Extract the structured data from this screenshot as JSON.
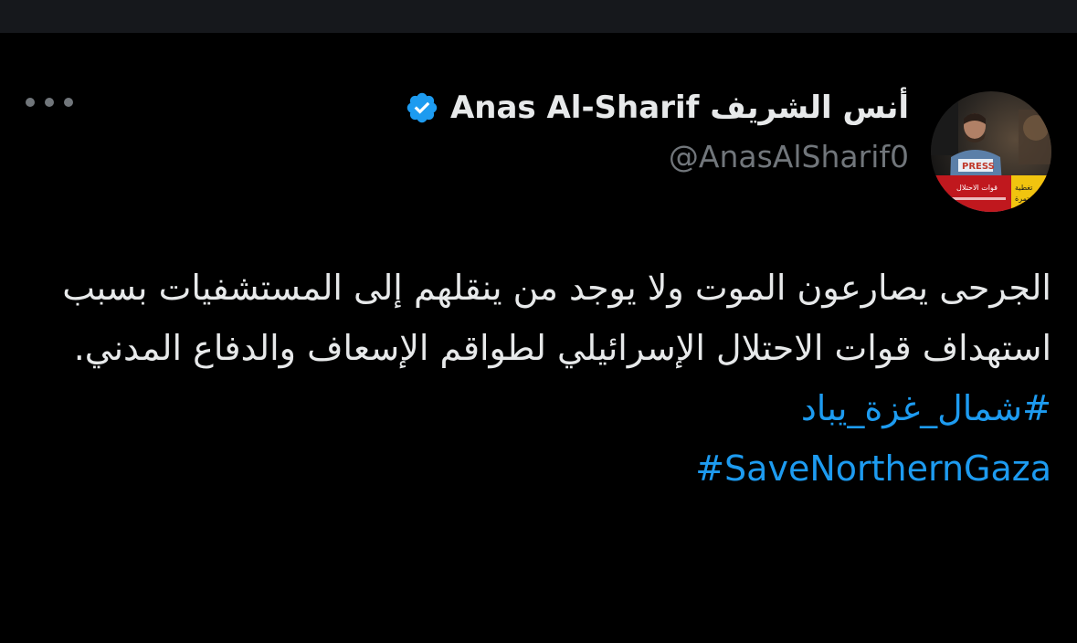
{
  "author": {
    "display_name": "أنس الشريف Anas Al-Sharif",
    "handle": "@AnasAlSharif0",
    "verified": true,
    "avatar_icon": "avatar-photo",
    "avatar_label": "قوات الاحتلال"
  },
  "tweet": {
    "text": "الجرحى يصارعون الموت ولا يوجد من ينقلهم إلى المستشفيات بسبب استهداف قوات الاحتلال الإسرائيلي لطواقم الإسعاف والدفاع المدني.",
    "hashtags": [
      "#شمال_غزة_يباد",
      "#SaveNorthernGaza"
    ]
  },
  "controls": {
    "more_icon": "more-horizontal-icon"
  },
  "colors": {
    "background": "#000000",
    "top_strip": "#16181c",
    "text": "#e7e9ea",
    "muted": "#71767b",
    "accent": "#1d9bf0"
  }
}
